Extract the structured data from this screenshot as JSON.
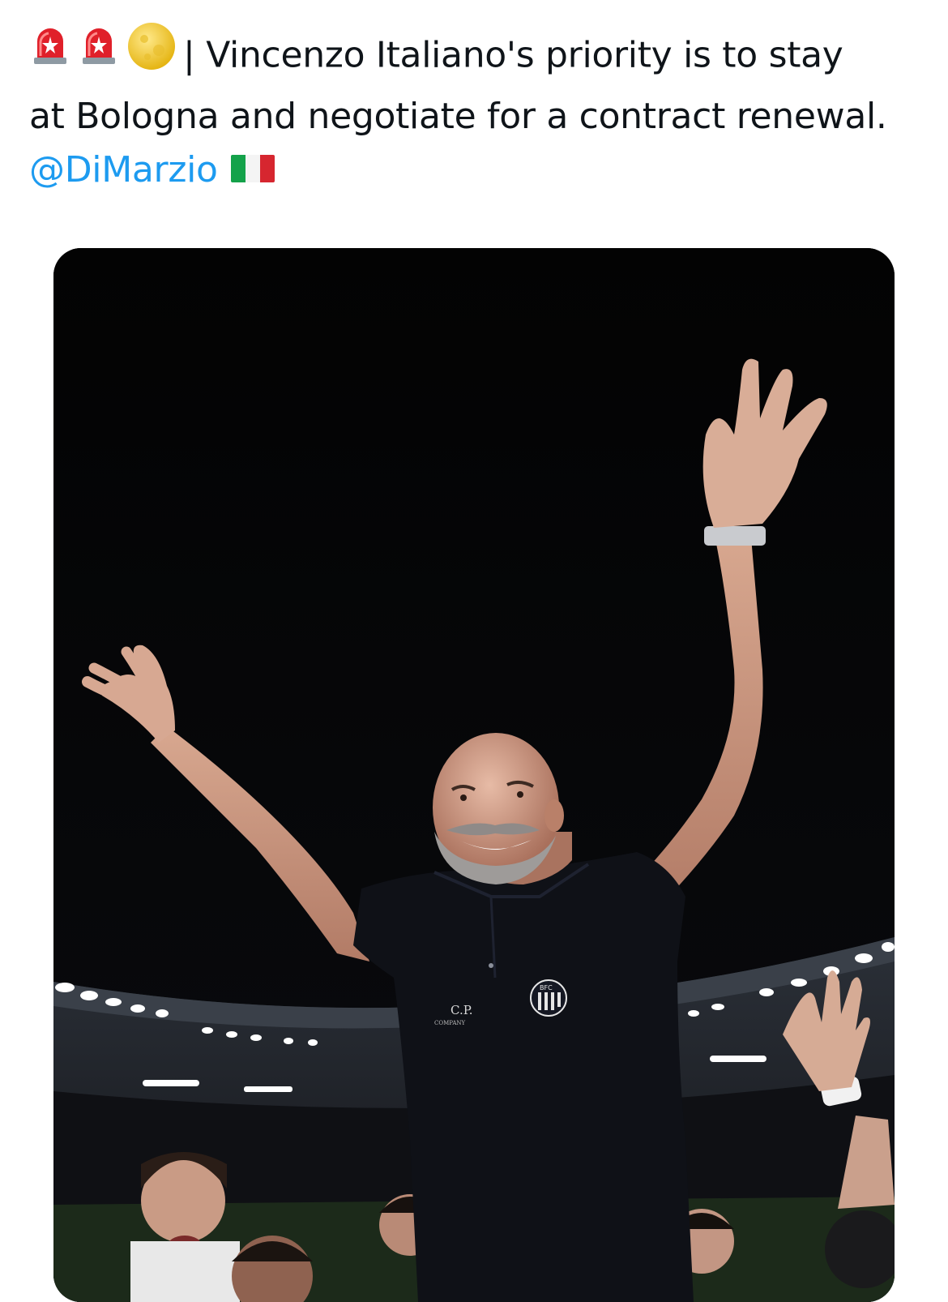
{
  "tweet": {
    "emojis": [
      "rotating-light-icon",
      "rotating-light-icon",
      "full-moon-icon"
    ],
    "text_line1": "| Vincenzo Italiano's priority is to stay",
    "text_line2": "at Bologna and negotiate for a contract renewal.",
    "mention": "@DiMarzio",
    "flag": "italy-flag-icon"
  },
  "photo": {
    "description_icon": "photo-media",
    "polo_logo_text": "C.P.",
    "polo_logo_subtext": "COMPANY",
    "crest_text": "BFC"
  },
  "colors": {
    "mention": "#1d9bf0",
    "text": "#0f1419",
    "photo_background": "#040404"
  }
}
